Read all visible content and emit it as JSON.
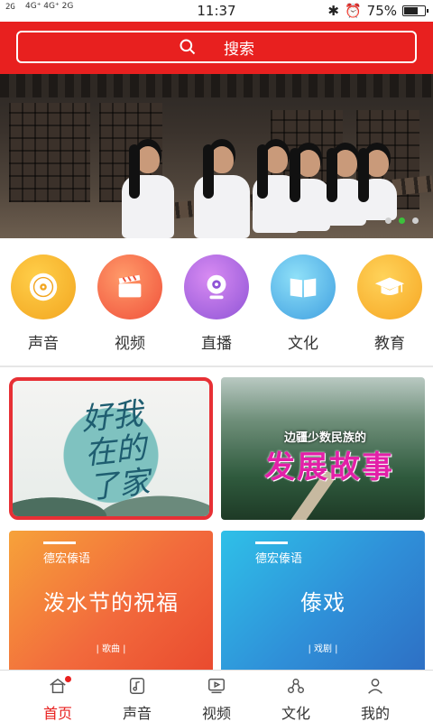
{
  "status_bar": {
    "signal_text": "2G",
    "network_text": "4G⁺ 4G⁺ 2G",
    "time": "11:37",
    "battery": "75%",
    "battery_level": 0.75
  },
  "search": {
    "label": "搜索",
    "icon": "search-icon"
  },
  "banner": {
    "slide_count": 3,
    "active_index": 1
  },
  "categories": [
    {
      "label": "声音",
      "icon": "vinyl-disc-icon",
      "color": "#f2a51f"
    },
    {
      "label": "视频",
      "icon": "clapperboard-icon",
      "color": "#f06a3c"
    },
    {
      "label": "直播",
      "icon": "webcam-icon",
      "color": "#b05fd8"
    },
    {
      "label": "文化",
      "icon": "open-book-icon",
      "color": "#4fb3e8"
    },
    {
      "label": "教育",
      "icon": "graduation-cap-icon",
      "color": "#f6a623"
    }
  ],
  "cards": {
    "c1": {
      "text": [
        "我",
        "的",
        "好",
        "在",
        "了",
        "家"
      ]
    },
    "c2": {
      "sub": "边疆少数民族的",
      "main": "发展故事"
    },
    "c3": {
      "brand": "德宏傣语",
      "title": "泼水节的祝福",
      "tag": "| 歌曲 |"
    },
    "c4": {
      "brand": "德宏傣语",
      "title": "傣戏",
      "tag": "| 戏剧 |"
    }
  },
  "tabs": [
    {
      "label": "首页",
      "icon": "home-icon",
      "active": true
    },
    {
      "label": "声音",
      "icon": "music-note-icon",
      "active": false
    },
    {
      "label": "视频",
      "icon": "video-player-icon",
      "active": false
    },
    {
      "label": "文化",
      "icon": "culture-icon",
      "active": false
    },
    {
      "label": "我的",
      "icon": "person-icon",
      "active": false
    }
  ],
  "colors": {
    "brand_red": "#e8201f",
    "card_border": "#e73035"
  }
}
